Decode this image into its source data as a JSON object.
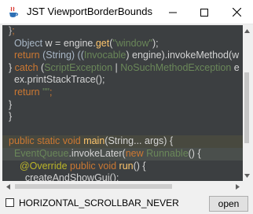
{
  "window": {
    "title": "JST ViewportBorderBounds"
  },
  "editor": {
    "lines": [
      [
        {
          "t": "}",
          "c": "#bbbbbb"
        },
        {
          "t": ";",
          "c": "#cc7832"
        }
      ],
      [
        {
          "t": "  Object ",
          "c": "#a9b7c6"
        },
        {
          "t": "w = engine.",
          "c": "#d4d4d4"
        },
        {
          "t": "get",
          "c": "#ffc66d"
        },
        {
          "t": "(",
          "c": "#d4d4d4"
        },
        {
          "t": "\"window\"",
          "c": "#6a8759"
        },
        {
          "t": ");",
          "c": "#d4d4d4"
        }
      ],
      [
        {
          "t": "  return ",
          "c": "#cc7832"
        },
        {
          "t": "(String) ((",
          "c": "#a9b7c6"
        },
        {
          "t": "Invocable",
          "c": "#6a8759"
        },
        {
          "t": ") engine).invokeMethod(w",
          "c": "#d4d4d4"
        }
      ],
      [
        {
          "t": "} ",
          "c": "#d4d4d4"
        },
        {
          "t": "catch ",
          "c": "#cc7832"
        },
        {
          "t": "(",
          "c": "#d4d4d4"
        },
        {
          "t": "ScriptException",
          "c": "#6a8759"
        },
        {
          "t": " | ",
          "c": "#d4d4d4"
        },
        {
          "t": "NoSuchMethodException",
          "c": "#6a8759"
        },
        {
          "t": " e",
          "c": "#d4d4d4"
        }
      ],
      [
        {
          "t": "  ex.printStackTrace();",
          "c": "#d4d4d4"
        }
      ],
      [
        {
          "t": "  return ",
          "c": "#cc7832"
        },
        {
          "t": "\"\"",
          "c": "#6a8759"
        },
        {
          "t": ";",
          "c": "#cc7832"
        }
      ],
      [
        {
          "t": "}",
          "c": "#d4d4d4"
        }
      ],
      [
        {
          "t": "}",
          "c": "#d4d4d4"
        }
      ],
      [
        {
          "t": "",
          "c": "#d4d4d4"
        }
      ],
      [
        {
          "t": "public static void ",
          "c": "#cc7832"
        },
        {
          "t": "main",
          "c": "#ffc66d"
        },
        {
          "t": "(String... args) {",
          "c": "#d4d4d4"
        }
      ],
      [
        {
          "t": "  ",
          "c": "#d4d4d4"
        },
        {
          "t": "EventQueue",
          "c": "#6a8759"
        },
        {
          "t": ".invokeLater(",
          "c": "#d4d4d4"
        },
        {
          "t": "new ",
          "c": "#cc7832"
        },
        {
          "t": "Runnable",
          "c": "#6a8759"
        },
        {
          "t": "() {",
          "c": "#d4d4d4"
        }
      ],
      [
        {
          "t": "    ",
          "c": "#d4d4d4"
        },
        {
          "t": "@Override ",
          "c": "#bbb529"
        },
        {
          "t": "public void ",
          "c": "#cc7832"
        },
        {
          "t": "run",
          "c": "#ffc66d"
        },
        {
          "t": "() {",
          "c": "#d4d4d4"
        }
      ],
      [
        {
          "t": "      createAndShowGui();",
          "c": "#d4d4d4"
        }
      ]
    ],
    "highlight_lines": [
      9,
      10
    ],
    "highlight_colors": [
      "#48493f",
      "#4a4f4c"
    ]
  },
  "footer": {
    "checkbox_label": "HORIZONTAL_SCROLLBAR_NEVER",
    "checkbox_checked": false,
    "open_button_label": "open"
  },
  "icons": {
    "app": "java-app-icon",
    "minimize": "minimize-icon",
    "maximize": "maximize-icon",
    "close": "close-icon"
  }
}
